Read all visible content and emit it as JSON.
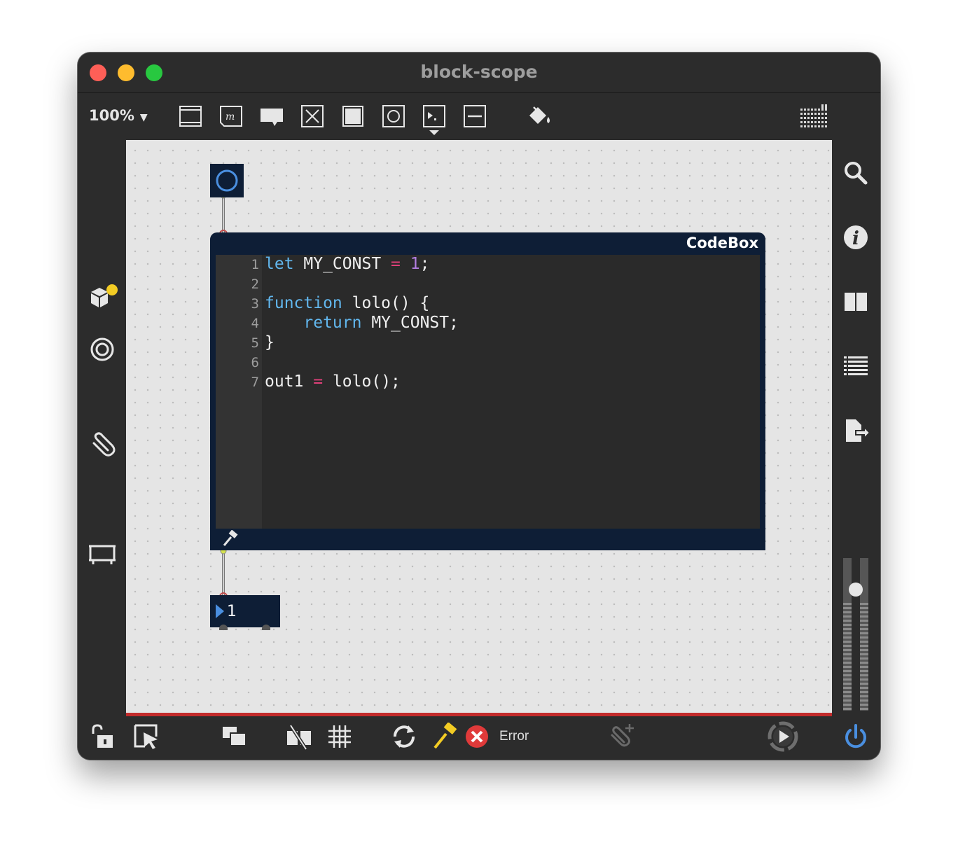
{
  "window": {
    "title": "block-scope"
  },
  "toolbar": {
    "zoom": "100%",
    "buttons": [
      "new-object-icon",
      "new-message-icon",
      "new-comment-icon",
      "new-toggle-icon",
      "new-bang-icon",
      "new-button-icon",
      "new-number-icon",
      "new-slider-icon",
      "paint-bucket-icon"
    ],
    "grid_icon": "grid-view-icon"
  },
  "left_sidebar": [
    "packages-icon",
    "target-icon",
    "paperclip-icon",
    "presentation-icon"
  ],
  "right_sidebar": [
    "search-icon",
    "info-icon",
    "split-view-icon",
    "list-icon",
    "export-icon"
  ],
  "patch": {
    "codebox_label": "CodeBox",
    "code_lines": [
      {
        "n": "1",
        "text": "let MY_CONST = 1;"
      },
      {
        "n": "2",
        "text": ""
      },
      {
        "n": "3",
        "text": "function lolo() {"
      },
      {
        "n": "4",
        "text": "    return MY_CONST;"
      },
      {
        "n": "5",
        "text": "}"
      },
      {
        "n": "6",
        "text": ""
      },
      {
        "n": "7",
        "text": "out1 = lolo();"
      }
    ],
    "number_value": "1"
  },
  "bottom_bar": {
    "status_text": "Error",
    "icons": [
      "lock-icon",
      "select-icon",
      "layers-icon",
      "hide-connections-icon",
      "grid-snap-icon",
      "refresh-icon",
      "hammer-icon",
      "error-icon",
      "add-attachment-icon",
      "play-icon",
      "power-icon"
    ]
  },
  "meter": {
    "level": 0.2
  },
  "colors": {
    "accent": "#4a8fe0",
    "error": "#e03a3a",
    "codebox_bg": "#0e1e36"
  }
}
